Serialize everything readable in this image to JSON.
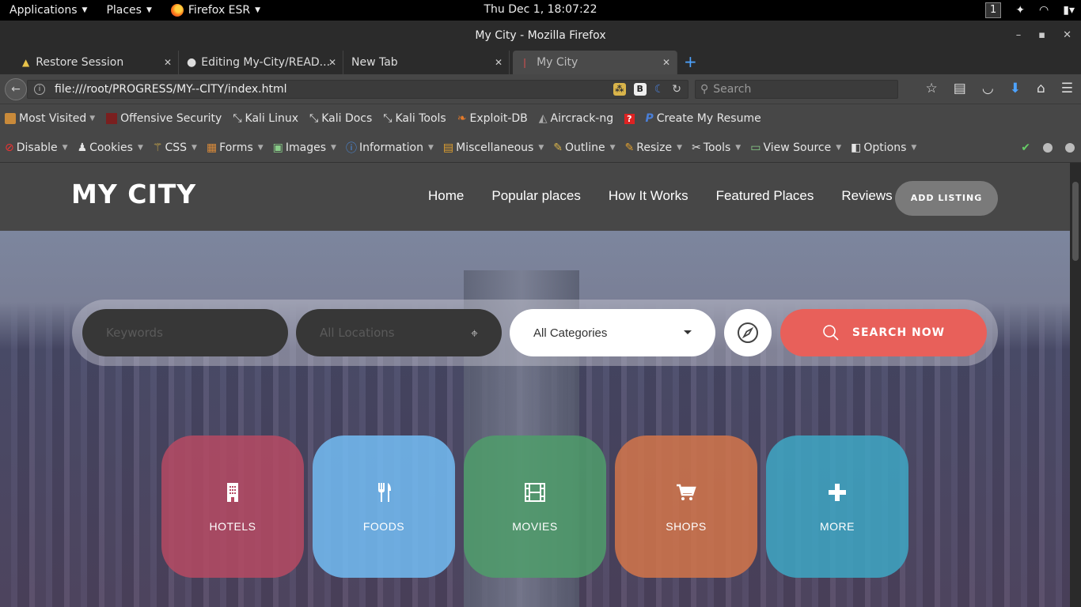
{
  "gnome": {
    "applications": "Applications",
    "places": "Places",
    "firefox": "Firefox ESR",
    "clock": "Thu Dec  1, 18:07:22",
    "workspace": "1"
  },
  "window": {
    "title": "My City - Mozilla Firefox"
  },
  "tabs": [
    {
      "label": "Restore Session"
    },
    {
      "label": "Editing My-City/READ..."
    },
    {
      "label": "New Tab"
    },
    {
      "label": "My City"
    }
  ],
  "nav": {
    "url": "file:///root/PROGRESS/MY--CITY/index.html",
    "search_placeholder": "Search"
  },
  "bookmarks": [
    {
      "label": "Most Visited"
    },
    {
      "label": "Offensive Security"
    },
    {
      "label": "Kali Linux"
    },
    {
      "label": "Kali Docs"
    },
    {
      "label": "Kali Tools"
    },
    {
      "label": "Exploit-DB"
    },
    {
      "label": "Aircrack-ng"
    },
    {
      "label": "Create My Resume"
    }
  ],
  "devbar": [
    {
      "label": "Disable"
    },
    {
      "label": "Cookies"
    },
    {
      "label": "CSS"
    },
    {
      "label": "Forms"
    },
    {
      "label": "Images"
    },
    {
      "label": "Information"
    },
    {
      "label": "Miscellaneous"
    },
    {
      "label": "Outline"
    },
    {
      "label": "Resize"
    },
    {
      "label": "Tools"
    },
    {
      "label": "View Source"
    },
    {
      "label": "Options"
    }
  ],
  "site": {
    "logo": "MY CITY",
    "nav": [
      "Home",
      "Popular places",
      "How It Works",
      "Featured Places",
      "Reviews"
    ],
    "add_listing": "ADD LISTING",
    "search": {
      "keywords_placeholder": "Keywords",
      "location_placeholder": "All Locations",
      "category": "All Categories",
      "button": "SEARCH NOW"
    },
    "categories": [
      {
        "label": "HOTELS",
        "color": "#b64a63"
      },
      {
        "label": "FOODS",
        "color": "#73bdf5"
      },
      {
        "label": "MOVIES",
        "color": "#4f9d6b"
      },
      {
        "label": "SHOPS",
        "color": "#d4764a"
      },
      {
        "label": "MORE",
        "color": "#3ea7c4"
      }
    ]
  },
  "colors": {
    "accent_search": "#e8605a",
    "header_bg": "#474747"
  }
}
